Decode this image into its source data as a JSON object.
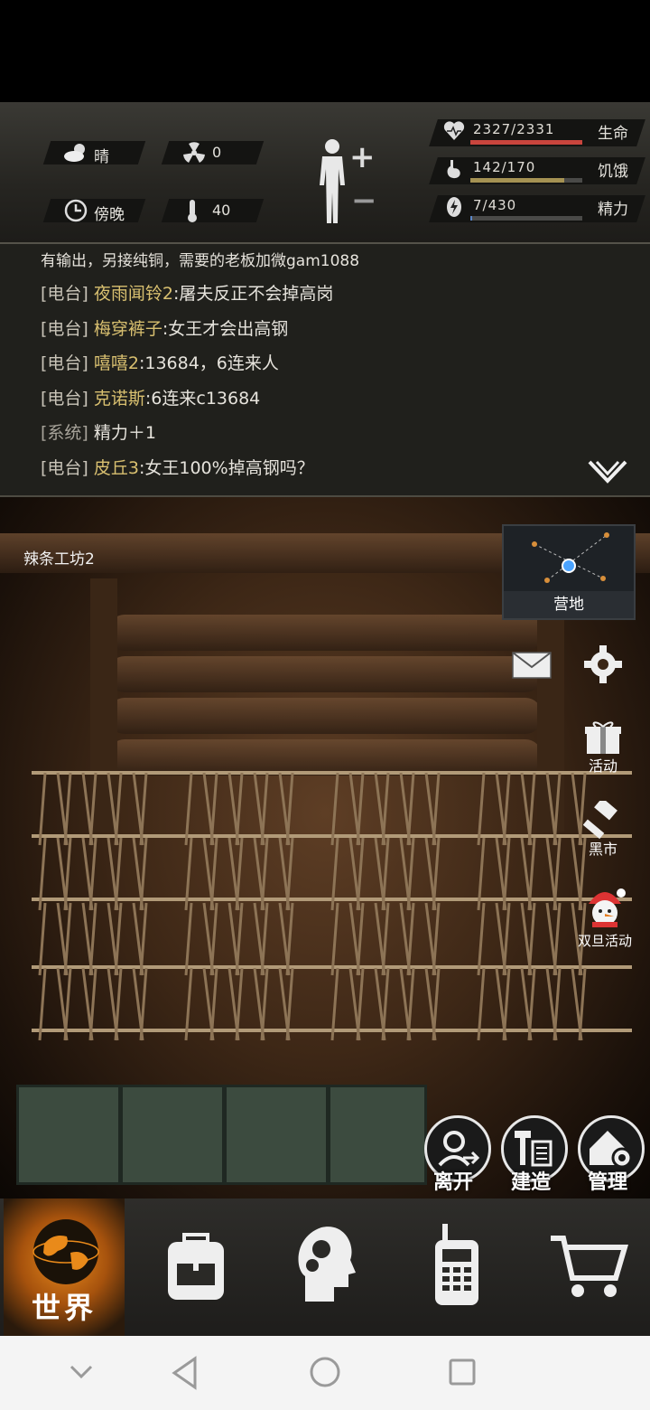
{
  "status": {
    "weather": {
      "icon": "cloud-sun-icon",
      "label": "晴"
    },
    "radiation": {
      "icon": "radiation-icon",
      "value": "0"
    },
    "time_of_day": {
      "icon": "clock-icon",
      "label": "傍晚"
    },
    "temperature": {
      "icon": "thermometer-icon",
      "value": "40"
    },
    "body_controls": {
      "plus": "+",
      "minus": "−"
    },
    "stats": [
      {
        "icon": "heart-icon",
        "value": "2327/2331",
        "label": "生命",
        "fill": 0.998,
        "color": "#c9453d"
      },
      {
        "icon": "stomach-icon",
        "value": "142/170",
        "label": "饥饿",
        "fill": 0.835,
        "color": "#a59253"
      },
      {
        "icon": "energy-icon",
        "value": "7/430",
        "label": "精力",
        "fill": 0.016,
        "color": "#5a86c8"
      }
    ]
  },
  "chat": {
    "partial_line": "有输出，另接纯铜，需要的老板加微gam1088",
    "lines": [
      {
        "tag": "[电台]",
        "name": "夜雨闻铃2",
        "msg": ":屠夫反正不会掉高岗"
      },
      {
        "tag": "[电台]",
        "name": "梅穿裤子",
        "msg": ":女王才会出高钢"
      },
      {
        "tag": "[电台]",
        "name": "嘻嘻2",
        "msg": ":13684，6连来人"
      },
      {
        "tag": "[电台]",
        "name": "克诺斯",
        "msg": ":6连来c13684"
      },
      {
        "tag": "[系统]",
        "name": "",
        "msg": "精力＋1"
      },
      {
        "tag": "[电台]",
        "name": "皮丘3",
        "msg": ":女王100%掉高钢吗？"
      }
    ]
  },
  "room": {
    "name": "辣条工坊2",
    "map_label": "营地",
    "side_buttons": [
      {
        "icon": "mail-icon",
        "label": ""
      },
      {
        "icon": "gear-icon",
        "label": ""
      },
      {
        "icon": "gift-icon",
        "label": "活动"
      },
      {
        "icon": "gavel-icon",
        "label": "黑市"
      },
      {
        "icon": "snowman-icon",
        "label": "双旦活动"
      }
    ],
    "action_buttons": [
      {
        "icon": "leave-icon",
        "label": "离开"
      },
      {
        "icon": "build-icon",
        "label": "建造"
      },
      {
        "icon": "manage-icon",
        "label": "管理"
      }
    ]
  },
  "bottom_nav": [
    {
      "icon": "globe-icon",
      "label": "世界"
    },
    {
      "icon": "backpack-icon",
      "label": ""
    },
    {
      "icon": "head-gears-icon",
      "label": ""
    },
    {
      "icon": "walkie-talkie-icon",
      "label": ""
    },
    {
      "icon": "cart-icon",
      "label": ""
    }
  ]
}
